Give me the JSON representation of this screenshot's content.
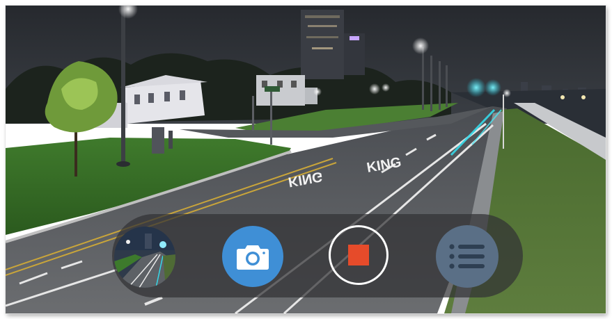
{
  "viewer": {
    "mode": "video-recording",
    "icons": {
      "thumbnail": "last-capture-thumbnail",
      "camera": "camera-icon",
      "record": "stop-square-icon",
      "list": "list-icon"
    },
    "colors": {
      "camera_button": "#3f8fd6",
      "record_stop": "#e64b2a",
      "list_button": "#5a6f86",
      "control_bar": "#323234"
    }
  },
  "scene": {
    "road_marking_1": "KING",
    "road_marking_2": "KING"
  }
}
